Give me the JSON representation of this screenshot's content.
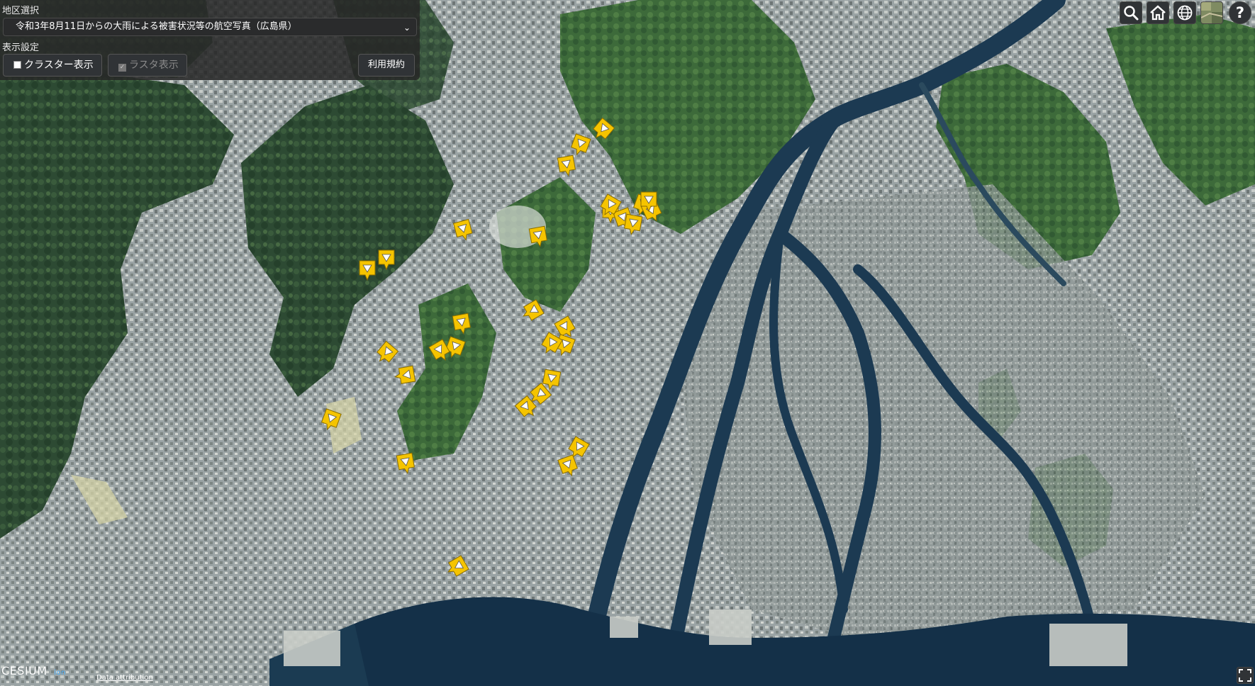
{
  "panel": {
    "district_label": "地区選択",
    "district_value": "令和3年8月11日からの大雨による被害状況等の航空写真（広島県）",
    "display_label": "表示設定",
    "cluster_label": "クラスター表示",
    "cluster_checked": false,
    "raster_label": "ラスタ表示",
    "raster_checked": true,
    "raster_disabled": true,
    "terms_label": "利用規約"
  },
  "toolbar": {
    "icons": [
      "search-icon",
      "home-icon",
      "globe-icon",
      "imagery-layer-icon",
      "help-icon"
    ],
    "help_label": "?"
  },
  "footer": {
    "cesium_label": "CESIUM",
    "cesium_ion": "ion",
    "attribution_label": "Data attribution"
  },
  "colors": {
    "marker": "#f5c400",
    "panel_bg": "#262626",
    "water": "#163047"
  },
  "markers": [
    [
      851,
      182,
      40
    ],
    [
      819,
      203,
      20
    ],
    [
      799,
      232,
      -10
    ],
    [
      861,
      298,
      0
    ],
    [
      879,
      307,
      -20
    ],
    [
      907,
      288,
      20
    ],
    [
      919,
      297,
      -25
    ],
    [
      893,
      315,
      10
    ],
    [
      915,
      282,
      0
    ],
    [
      861,
      289,
      30
    ],
    [
      653,
      323,
      -15
    ],
    [
      759,
      332,
      -10
    ],
    [
      545,
      364,
      0
    ],
    [
      518,
      379,
      0
    ],
    [
      752,
      438,
      60
    ],
    [
      651,
      455,
      -10
    ],
    [
      642,
      489,
      20
    ],
    [
      620,
      494,
      -30
    ],
    [
      546,
      497,
      40
    ],
    [
      573,
      529,
      80
    ],
    [
      797,
      461,
      -30
    ],
    [
      797,
      486,
      20
    ],
    [
      778,
      484,
      30
    ],
    [
      778,
      534,
      10
    ],
    [
      762,
      556,
      50
    ],
    [
      742,
      574,
      -40
    ],
    [
      467,
      591,
      20
    ],
    [
      572,
      652,
      -10
    ],
    [
      816,
      631,
      30
    ],
    [
      801,
      656,
      -20
    ],
    [
      646,
      799,
      60
    ]
  ]
}
